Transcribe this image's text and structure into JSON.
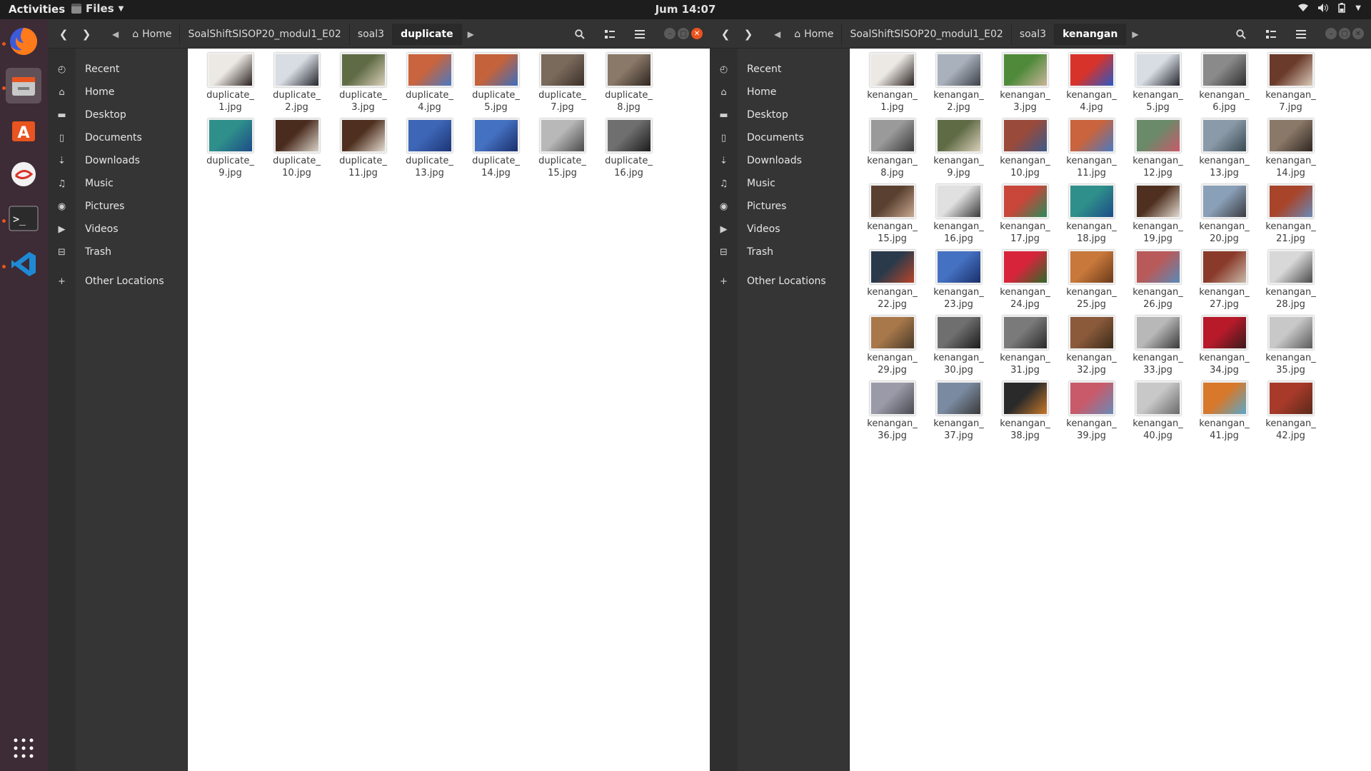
{
  "topbar": {
    "activities": "Activities",
    "app": "Files",
    "clock": "Jum 14:07"
  },
  "sidebar_items": [
    {
      "label": "Recent",
      "icon": "clock-icon"
    },
    {
      "label": "Home",
      "icon": "home-icon"
    },
    {
      "label": "Desktop",
      "icon": "folder-icon"
    },
    {
      "label": "Documents",
      "icon": "document-icon"
    },
    {
      "label": "Downloads",
      "icon": "download-icon"
    },
    {
      "label": "Music",
      "icon": "music-icon"
    },
    {
      "label": "Pictures",
      "icon": "camera-icon"
    },
    {
      "label": "Videos",
      "icon": "video-icon"
    },
    {
      "label": "Trash",
      "icon": "trash-icon"
    },
    {
      "label": "Other Locations",
      "icon": "plus-icon"
    }
  ],
  "left": {
    "crumbs": [
      "Home",
      "SoalShiftSISOP20_modul1_E02",
      "soal3",
      "duplicate"
    ],
    "files": [
      {
        "l1": "duplicate_",
        "l2": "1.jpg",
        "c": [
          "#ece8e4",
          "#2a2220"
        ]
      },
      {
        "l1": "duplicate_",
        "l2": "2.jpg",
        "c": [
          "#d8dde4",
          "#24262c"
        ]
      },
      {
        "l1": "duplicate_",
        "l2": "3.jpg",
        "c": [
          "#5f6b45",
          "#d9cfb9"
        ]
      },
      {
        "l1": "duplicate_",
        "l2": "4.jpg",
        "c": [
          "#c9643e",
          "#4a79c2"
        ]
      },
      {
        "l1": "duplicate_",
        "l2": "5.jpg",
        "c": [
          "#c4623b",
          "#3d6fbe"
        ]
      },
      {
        "l1": "duplicate_",
        "l2": "7.jpg",
        "c": [
          "#7a6a5c",
          "#3b3028"
        ]
      },
      {
        "l1": "duplicate_",
        "l2": "8.jpg",
        "c": [
          "#8a7868",
          "#2f2620"
        ]
      },
      {
        "l1": "duplicate_",
        "l2": "9.jpg",
        "c": [
          "#2f8f8a",
          "#1c4c88"
        ]
      },
      {
        "l1": "duplicate_",
        "l2": "10.jpg",
        "c": [
          "#4a2c1e",
          "#d9d2c8"
        ]
      },
      {
        "l1": "duplicate_",
        "l2": "11.jpg",
        "c": [
          "#4f3020",
          "#e3dbd0"
        ]
      },
      {
        "l1": "duplicate_",
        "l2": "13.jpg",
        "c": [
          "#3d66b6",
          "#1d3576"
        ]
      },
      {
        "l1": "duplicate_",
        "l2": "14.jpg",
        "c": [
          "#4571c2",
          "#1a2f6a"
        ]
      },
      {
        "l1": "duplicate_",
        "l2": "15.jpg",
        "c": [
          "#b8b8b8",
          "#4a4a4a"
        ]
      },
      {
        "l1": "duplicate_",
        "l2": "16.jpg",
        "c": [
          "#6f6f6f",
          "#1c1c1c"
        ]
      }
    ]
  },
  "right": {
    "crumbs": [
      "Home",
      "SoalShiftSISOP20_modul1_E02",
      "soal3",
      "kenangan"
    ],
    "files": [
      {
        "l1": "kenangan_",
        "l2": "1.jpg",
        "c": [
          "#ece8e4",
          "#2a2220"
        ]
      },
      {
        "l1": "kenangan_",
        "l2": "2.jpg",
        "c": [
          "#a9b1bc",
          "#3d4148"
        ]
      },
      {
        "l1": "kenangan_",
        "l2": "3.jpg",
        "c": [
          "#4f8a3a",
          "#c9b59a"
        ]
      },
      {
        "l1": "kenangan_",
        "l2": "4.jpg",
        "c": [
          "#d8332a",
          "#2a58c4"
        ]
      },
      {
        "l1": "kenangan_",
        "l2": "5.jpg",
        "c": [
          "#d8dde4",
          "#24262c"
        ]
      },
      {
        "l1": "kenangan_",
        "l2": "6.jpg",
        "c": [
          "#8a8a8a",
          "#2f2f2f"
        ]
      },
      {
        "l1": "kenangan_",
        "l2": "7.jpg",
        "c": [
          "#6a3a2a",
          "#d9c9b9"
        ]
      },
      {
        "l1": "kenangan_",
        "l2": "8.jpg",
        "c": [
          "#9a9a9a",
          "#3a3a3a"
        ]
      },
      {
        "l1": "kenangan_",
        "l2": "9.jpg",
        "c": [
          "#5f6b45",
          "#d9cfb9"
        ]
      },
      {
        "l1": "kenangan_",
        "l2": "10.jpg",
        "c": [
          "#9a4a3a",
          "#3a5a8a"
        ]
      },
      {
        "l1": "kenangan_",
        "l2": "11.jpg",
        "c": [
          "#c9643e",
          "#4a79c2"
        ]
      },
      {
        "l1": "kenangan_",
        "l2": "12.jpg",
        "c": [
          "#6a8a6a",
          "#c95a6a"
        ]
      },
      {
        "l1": "kenangan_",
        "l2": "13.jpg",
        "c": [
          "#8a9aa8",
          "#3a4a52"
        ]
      },
      {
        "l1": "kenangan_",
        "l2": "14.jpg",
        "c": [
          "#8a7868",
          "#2f2620"
        ]
      },
      {
        "l1": "kenangan_",
        "l2": "15.jpg",
        "c": [
          "#5a4030",
          "#c8a890"
        ]
      },
      {
        "l1": "kenangan_",
        "l2": "16.jpg",
        "c": [
          "#e0e0e0",
          "#3a3a3a"
        ]
      },
      {
        "l1": "kenangan_",
        "l2": "17.jpg",
        "c": [
          "#c8463a",
          "#2a8a5a"
        ]
      },
      {
        "l1": "kenangan_",
        "l2": "18.jpg",
        "c": [
          "#2f8f8a",
          "#1c4c88"
        ]
      },
      {
        "l1": "kenangan_",
        "l2": "19.jpg",
        "c": [
          "#4f3020",
          "#e3dbd0"
        ]
      },
      {
        "l1": "kenangan_",
        "l2": "20.jpg",
        "c": [
          "#8aa0b8",
          "#3a3a40"
        ]
      },
      {
        "l1": "kenangan_",
        "l2": "21.jpg",
        "c": [
          "#a8442a",
          "#6a8ab8"
        ]
      },
      {
        "l1": "kenangan_",
        "l2": "22.jpg",
        "c": [
          "#2a3a4a",
          "#b8442a"
        ]
      },
      {
        "l1": "kenangan_",
        "l2": "23.jpg",
        "c": [
          "#4571c2",
          "#1a2f6a"
        ]
      },
      {
        "l1": "kenangan_",
        "l2": "24.jpg",
        "c": [
          "#d8243a",
          "#2f6a2a"
        ]
      },
      {
        "l1": "kenangan_",
        "l2": "25.jpg",
        "c": [
          "#c8783a",
          "#6a3a1a"
        ]
      },
      {
        "l1": "kenangan_",
        "l2": "26.jpg",
        "c": [
          "#b85a5a",
          "#5a8ab8"
        ]
      },
      {
        "l1": "kenangan_",
        "l2": "27.jpg",
        "c": [
          "#8a3a2a",
          "#c8b8a8"
        ]
      },
      {
        "l1": "kenangan_",
        "l2": "28.jpg",
        "c": [
          "#d8d8d8",
          "#4a4a4a"
        ]
      },
      {
        "l1": "kenangan_",
        "l2": "29.jpg",
        "c": [
          "#a8784a",
          "#4a3a2a"
        ]
      },
      {
        "l1": "kenangan_",
        "l2": "30.jpg",
        "c": [
          "#6f6f6f",
          "#1c1c1c"
        ]
      },
      {
        "l1": "kenangan_",
        "l2": "31.jpg",
        "c": [
          "#7a7a7a",
          "#2a2a2a"
        ]
      },
      {
        "l1": "kenangan_",
        "l2": "32.jpg",
        "c": [
          "#8a5a3a",
          "#3a2a1a"
        ]
      },
      {
        "l1": "kenangan_",
        "l2": "33.jpg",
        "c": [
          "#b8b8b8",
          "#3a3a3a"
        ]
      },
      {
        "l1": "kenangan_",
        "l2": "34.jpg",
        "c": [
          "#b81a2a",
          "#3a1a1a"
        ]
      },
      {
        "l1": "kenangan_",
        "l2": "35.jpg",
        "c": [
          "#c8c8c8",
          "#5a5a5a"
        ]
      },
      {
        "l1": "kenangan_",
        "l2": "36.jpg",
        "c": [
          "#9a9aa8",
          "#4a4a52"
        ]
      },
      {
        "l1": "kenangan_",
        "l2": "37.jpg",
        "c": [
          "#7a8aa0",
          "#3a3a3a"
        ]
      },
      {
        "l1": "kenangan_",
        "l2": "38.jpg",
        "c": [
          "#2a2a2a",
          "#c8782a"
        ]
      },
      {
        "l1": "kenangan_",
        "l2": "39.jpg",
        "c": [
          "#c85a6a",
          "#6a8ab8"
        ]
      },
      {
        "l1": "kenangan_",
        "l2": "40.jpg",
        "c": [
          "#c8c8c8",
          "#6a6a6a"
        ]
      },
      {
        "l1": "kenangan_",
        "l2": "41.jpg",
        "c": [
          "#d8782a",
          "#5aa8c8"
        ]
      },
      {
        "l1": "kenangan_",
        "l2": "42.jpg",
        "c": [
          "#a83a2a",
          "#5a2a1a"
        ]
      }
    ]
  },
  "colors": {
    "accent": "#e95420",
    "headerbar": "#333333",
    "sidebar": "#353535",
    "dock": "#3d2b35"
  }
}
